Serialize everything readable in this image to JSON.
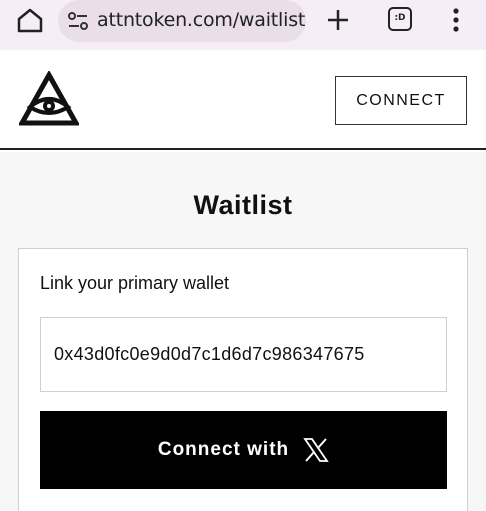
{
  "browser": {
    "url": "attntoken.com/waitlist",
    "tab_count_label": ":D",
    "icons": {
      "home": "home-icon",
      "site_info": "site-settings-icon",
      "new_tab": "plus-icon",
      "menu": "more-vert-icon"
    }
  },
  "header": {
    "logo_icon": "eye-triangle-logo",
    "connect_label": "CONNECT"
  },
  "main": {
    "title": "Waitlist",
    "wallet_label": "Link your primary wallet",
    "wallet_value": "0x43d0fc0e9d0d7c1d6d7c986347675",
    "connect_x_label": "Connect with",
    "x_icon": "x-logo-icon"
  },
  "colors": {
    "chrome_bg": "#f6eef6",
    "urlbar_bg": "#e9dee9",
    "page_bg": "#f7f7f7",
    "primary_button_bg": "#000000",
    "primary_button_text": "#ffffff"
  }
}
